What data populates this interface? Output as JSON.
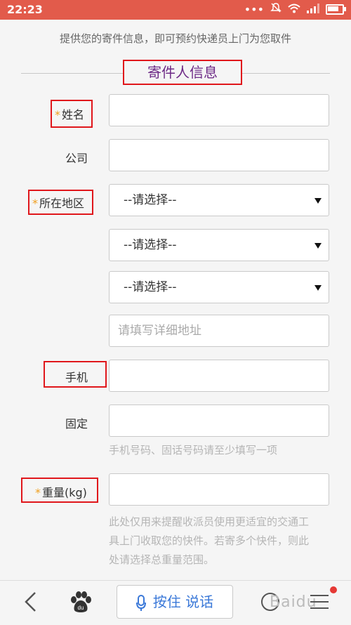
{
  "status_bar": {
    "time": "22:23",
    "icons": [
      "more-icon",
      "mute-icon",
      "wifi-icon",
      "signal-icon",
      "battery-icon"
    ],
    "battery_level": 0.75
  },
  "intro": "提供您的寄件信息，即可预约快递员上门为您取件",
  "section_title": "寄件人信息",
  "form": {
    "name_label": "姓名",
    "company_label": "公司",
    "region_label": "所在地区",
    "select_placeholder_1": "--请选择--",
    "select_placeholder_2": "--请选择--",
    "select_placeholder_3": "--请选择--",
    "address_placeholder": "请填写详细地址",
    "mobile_label": "手机",
    "phone_label": "固定",
    "phone_hint": "手机号码、固话号码请至少填写一项",
    "weight_label": "重量(kg)",
    "weight_hint_1": "此处仅用来提醒收派员使用更适宜的交通工",
    "weight_hint_2": "具上门收取您的快件。若寄多个快件，则此",
    "weight_hint_3": "处请选择总重量范围。",
    "required_mark": "*"
  },
  "bottom_bar": {
    "voice_label": "按住 说话",
    "watermark": "Baidu"
  },
  "colors": {
    "status_bar": "#e25b4b",
    "highlight_box": "#e0161b",
    "section_title": "#6d2a86",
    "required": "#f0a020",
    "voice": "#3a78d8"
  }
}
